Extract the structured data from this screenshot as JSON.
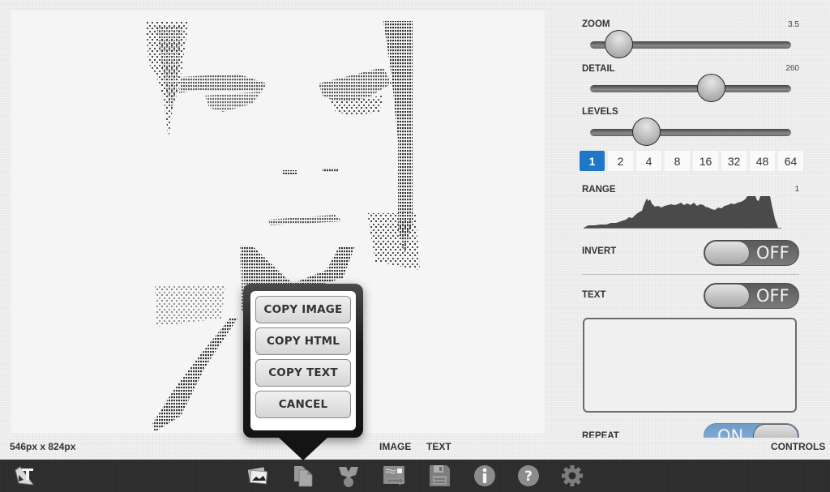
{
  "canvas": {
    "image_description": "ASCII-art rendering of a face",
    "dimensions_label": "546px x 824px"
  },
  "view_tabs": {
    "image_label": "IMAGE",
    "text_label": "TEXT",
    "controls_label": "CONTROLS"
  },
  "controls": {
    "zoom": {
      "label": "ZOOM",
      "value": "3.5",
      "position_fraction": 0.14
    },
    "detail": {
      "label": "DETAIL",
      "value": "260",
      "position_fraction": 0.6
    },
    "levels": {
      "label": "LEVELS",
      "position_fraction": 0.28,
      "options": [
        "1",
        "2",
        "4",
        "8",
        "16",
        "32",
        "48",
        "64"
      ],
      "selected": "1"
    },
    "range": {
      "label": "RANGE",
      "value": "1"
    },
    "invert": {
      "label": "INVERT",
      "state": "OFF"
    },
    "text": {
      "label": "TEXT",
      "state": "OFF",
      "textarea_value": ""
    },
    "repeat": {
      "label": "REPEAT",
      "state": "ON"
    }
  },
  "popover": {
    "buttons": [
      {
        "id": "copy-image",
        "label": "COPY IMAGE"
      },
      {
        "id": "copy-html",
        "label": "COPY HTML"
      },
      {
        "id": "copy-text",
        "label": "COPY TEXT"
      },
      {
        "id": "cancel",
        "label": "CANCEL"
      }
    ]
  },
  "toolbar": {
    "items": [
      {
        "icon": "app-logo-icon"
      },
      {
        "icon": "photos-icon"
      },
      {
        "icon": "copy-documents-icon"
      },
      {
        "icon": "share-icon"
      },
      {
        "icon": "export-icon"
      },
      {
        "icon": "save-disk-icon"
      },
      {
        "icon": "info-icon"
      },
      {
        "icon": "help-icon"
      },
      {
        "icon": "settings-gear-icon"
      }
    ]
  },
  "colors": {
    "accent": "#1f77c8",
    "toolbar_bg": "#2d2d2d",
    "toggle_on": "#7ea8d4"
  }
}
